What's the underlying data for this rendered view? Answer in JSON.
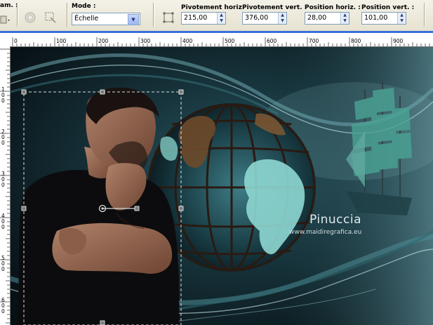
{
  "toolbar": {
    "presets_label_fragment": "am. :",
    "mode": {
      "label": "Mode :",
      "value": "Échelle"
    },
    "pivot_h": {
      "label": "Pivotement horiz. :",
      "value": "215,00"
    },
    "pivot_v": {
      "label": "Pivotement vert. :",
      "value": "376,00"
    },
    "pos_h": {
      "label": "Position horiz. :",
      "value": "28,00"
    },
    "pos_v": {
      "label": "Position vert. :",
      "value": "101,00"
    }
  },
  "ruler": {
    "top_ticks": [
      "0",
      "100",
      "200",
      "300",
      "400",
      "500",
      "600",
      "700",
      "800",
      "900"
    ],
    "left_ticks": [
      "1\n0\n0",
      "2\n0\n0",
      "3\n0\n0",
      "4\n0\n0",
      "5\n0\n0",
      "6\n0\n0"
    ]
  },
  "canvas": {
    "watermark_name": "Pinuccia",
    "watermark_url": "www.maidiregrafica.eu"
  },
  "colors": {
    "accent": "#3a6fd8",
    "selection": "#ffffff",
    "canvas_dark": "#0c1a20",
    "teal": "#2e6a74"
  }
}
